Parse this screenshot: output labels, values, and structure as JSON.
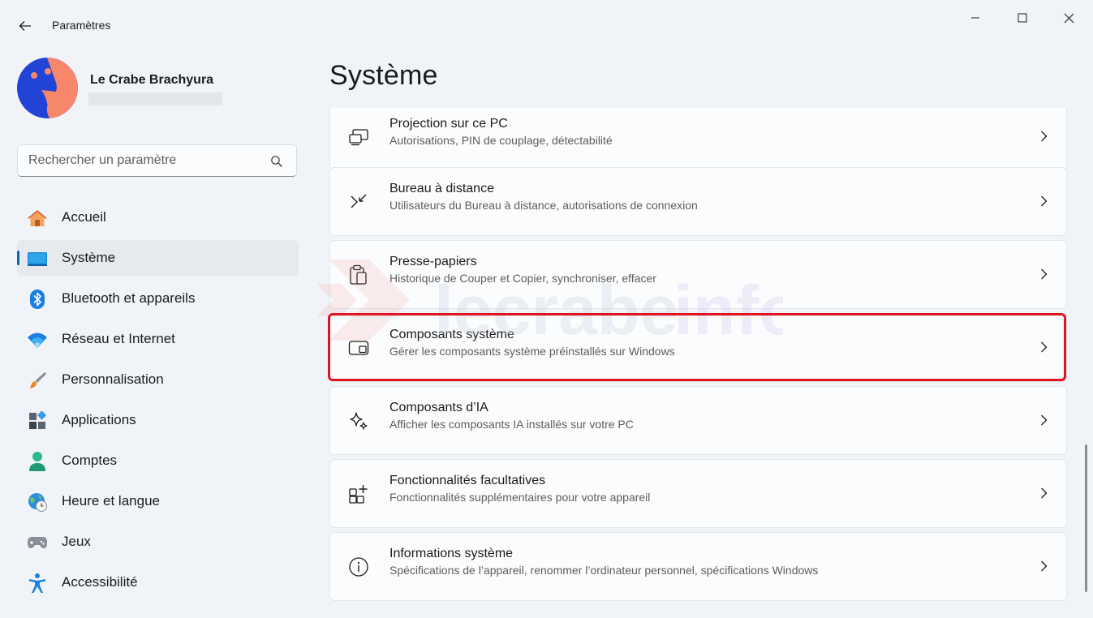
{
  "window": {
    "title": "Paramètres"
  },
  "user": {
    "name": "Le Crabe Brachyura"
  },
  "search": {
    "placeholder": "Rechercher un paramètre"
  },
  "nav": {
    "items": [
      {
        "label": "Accueil",
        "icon": "home-icon",
        "active": false
      },
      {
        "label": "Système",
        "icon": "system-display-icon",
        "active": true
      },
      {
        "label": "Bluetooth et appareils",
        "icon": "bluetooth-icon",
        "active": false
      },
      {
        "label": "Réseau et Internet",
        "icon": "wifi-icon",
        "active": false
      },
      {
        "label": "Personnalisation",
        "icon": "paintbrush-icon",
        "active": false
      },
      {
        "label": "Applications",
        "icon": "apps-icon",
        "active": false
      },
      {
        "label": "Comptes",
        "icon": "account-icon",
        "active": false
      },
      {
        "label": "Heure et langue",
        "icon": "globe-clock-icon",
        "active": false
      },
      {
        "label": "Jeux",
        "icon": "gamepad-icon",
        "active": false
      },
      {
        "label": "Accessibilité",
        "icon": "accessibility-icon",
        "active": false
      }
    ]
  },
  "main": {
    "title": "Système",
    "cards": [
      {
        "title": "Projection sur ce PC",
        "desc": "Autorisations, PIN de couplage, détectabilité",
        "icon": "projection-icon"
      },
      {
        "title": "Bureau à distance",
        "desc": "Utilisateurs du Bureau à distance, autorisations de connexion",
        "icon": "remote-desktop-icon"
      },
      {
        "title": "Presse-papiers",
        "desc": "Historique de Couper et Copier, synchroniser, effacer",
        "icon": "clipboard-icon"
      },
      {
        "title": "Composants système",
        "desc": "Gérer les composants système préinstallés sur Windows",
        "icon": "system-components-icon",
        "highlighted": true
      },
      {
        "title": "Composants d’IA",
        "desc": "Afficher les composants IA installés sur votre PC",
        "icon": "sparkle-icon"
      },
      {
        "title": "Fonctionnalités facultatives",
        "desc": "Fonctionnalités supplémentaires pour votre appareil",
        "icon": "add-apps-icon"
      },
      {
        "title": "Informations système",
        "desc": "Spécifications de l’appareil, renommer l’ordinateur personnel, spécifications Windows",
        "icon": "info-icon"
      }
    ]
  },
  "watermark": {
    "text": "lecrabeinfo"
  },
  "colors": {
    "accent": "#0067c0",
    "highlight_border": "#e0141e",
    "background": "#f0f4f9",
    "card_bg": "#fbfcfd"
  }
}
